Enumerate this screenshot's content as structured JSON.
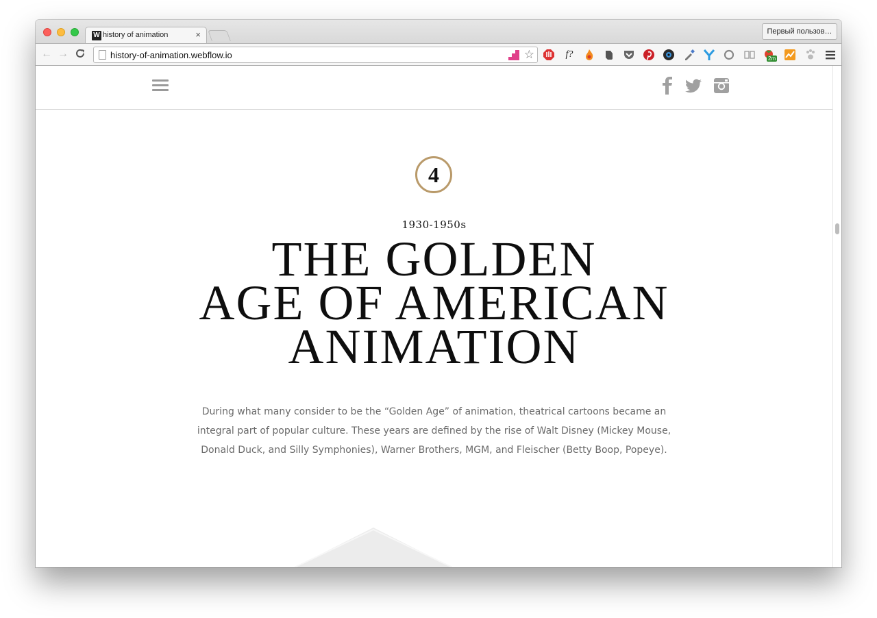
{
  "browser": {
    "tab_title": "history of animation",
    "tab_favicon_letter": "W",
    "close_glyph": "×",
    "profile_label": "Первый пользов…",
    "url": "history-of-animation.webflow.io",
    "nav": {
      "back": "←",
      "forward": "→",
      "reload": "C"
    },
    "star": "☆"
  },
  "page": {
    "chapter_number": "4",
    "era": "1930-1950s",
    "headline_lines": [
      "THE GOLDEN",
      "AGE OF AMERICAN",
      "ANIMATION"
    ],
    "intro_lines": [
      "During what many consider to be the “Golden Age” of animation, theatrical cartoons became an",
      "integral part of popular culture. These years are defined by the rise of Walt Disney (Mickey Mouse,",
      "Donald Duck, and Silly Symphonies), Warner Brothers, MGM, and Fleischer (Betty Boop, Popeye)."
    ]
  },
  "extensions": {
    "badge_2m": "2m",
    "formula_label": "f?"
  },
  "colors": {
    "accent_circle": "#b99a6a",
    "social_icon": "#a0a0a0",
    "text_body": "#6a6a6a"
  }
}
